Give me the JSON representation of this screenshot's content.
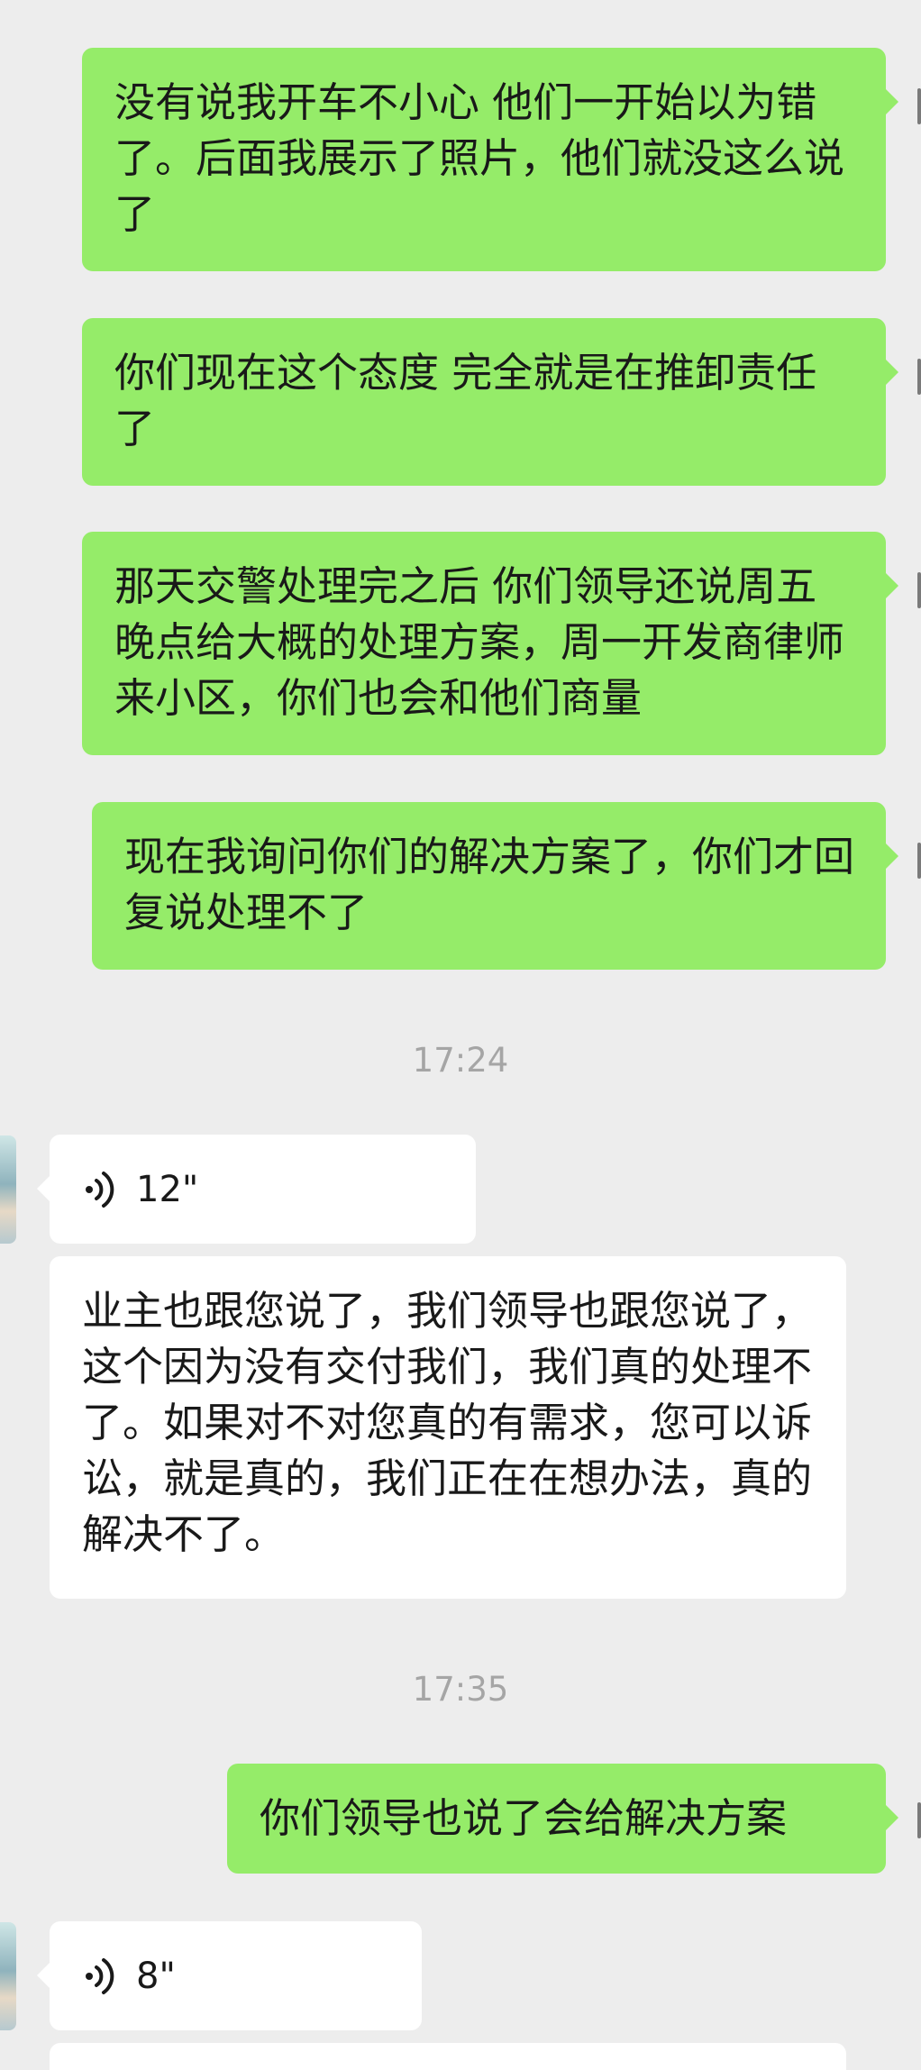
{
  "messages": [
    {
      "type": "sent",
      "text": "没有说我开车不小心 他们一开始以为错了。后面我展示了照片，他们就没这么说了"
    },
    {
      "type": "sent",
      "text": "你们现在这个态度 完全就是在推卸责任了"
    },
    {
      "type": "sent",
      "text": "那天交警处理完之后 你们领导还说周五晚点给大概的处理方案，周一开发商律师来小区，你们也会和他们商量"
    },
    {
      "type": "sent",
      "text": "现在我询问你们的解决方案了，你们才回复说处理不了"
    },
    {
      "type": "time",
      "text": "17:24"
    },
    {
      "type": "voice",
      "duration": "12\""
    },
    {
      "type": "recv",
      "text": "业主也跟您说了，我们领导也跟您说了，这个因为没有交付我们，我们真的处理不了。如果对不对您真的有需求，您可以诉讼，就是真的，我们正在在想办法，真的解决不了。"
    },
    {
      "type": "time",
      "text": "17:35"
    },
    {
      "type": "sent",
      "text": "你们领导也说了会给解决方案"
    },
    {
      "type": "voice",
      "duration": "8\""
    }
  ],
  "colors": {
    "background": "#ededed",
    "sent_bubble": "#95ec69",
    "received_bubble": "#ffffff",
    "timestamp_text": "#a5a5a5"
  },
  "icons": {
    "voice": "voice-wave-icon",
    "avatar": "contact-avatar"
  }
}
